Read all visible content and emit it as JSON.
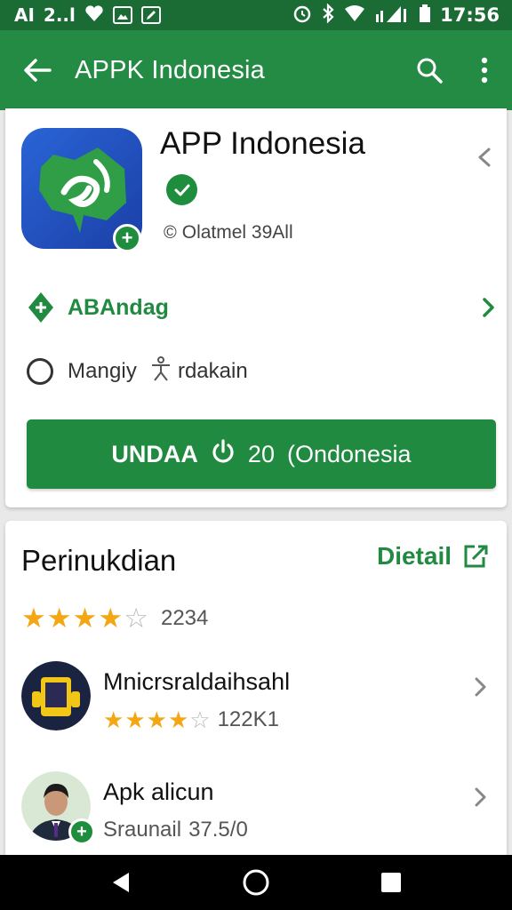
{
  "status_bar": {
    "left_text": "AI",
    "left_text_2": "2..l",
    "time": "17:56"
  },
  "app_bar": {
    "title": "APPK Indonesia",
    "icons": [
      "back-arrow-icon",
      "search-icon",
      "more-vert-icon"
    ]
  },
  "app": {
    "name": "APP Indonesia",
    "developer": "Olatmel 39All",
    "category": "ABAndag",
    "option_label": "Mangiy",
    "option_tail": "rdakain",
    "install_label": "UNDAA",
    "install_mid": "20",
    "install_suffix": "(Ondonesia",
    "colors": {
      "primary": "#238b43",
      "accent": "#1f8a40",
      "icon_bg": "#2a64d6"
    }
  },
  "reviews": {
    "title": "Perinukdian",
    "detail_label": "Dietail",
    "rating": 4.5,
    "rating_count": "2234",
    "items": [
      {
        "title": "Mnicrsraldaihsahl",
        "rating": 4.5,
        "count": "122K1"
      },
      {
        "title": "Apk alicun",
        "subtitle": "Sraunail",
        "count": "37.5/0"
      }
    ]
  },
  "nav_bar": {
    "icons": [
      "back-triangle-icon",
      "home-circle-icon",
      "recents-square-icon"
    ]
  }
}
